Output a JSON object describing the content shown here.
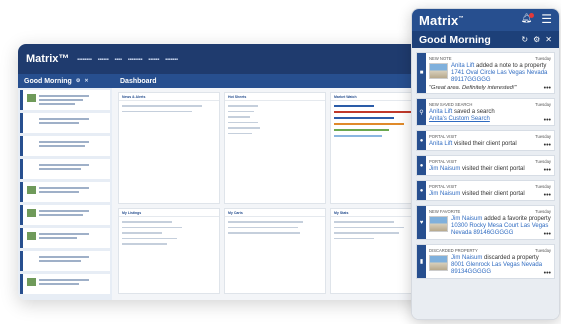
{
  "desktop": {
    "logo": "Matrix™",
    "good_morning": "Good Morning",
    "dashboard": "Dashboard",
    "widgets": {
      "news": "News & Alerts",
      "hot_sheets": "Hot Sheets",
      "market_watch": "Market Watch",
      "my_listings": "My Listings",
      "my_carts": "My Carts",
      "my_stats": "My Stats"
    }
  },
  "phone": {
    "logo": "Matrix",
    "logo_tm": "™",
    "good_morning": "Good Morning",
    "feed": [
      {
        "type": "NEW NOTE",
        "day": "Tuesday",
        "name": "Anita Lift",
        "action": " added a note to a property",
        "address": "1741 Oval Circle Las Vegas Nevada 89117GGGGG",
        "quote": "\"Great area. Definitely interested!\"",
        "icon": "note-icon"
      },
      {
        "type": "NEW SAVED SEARCH",
        "day": "Tuesday",
        "name": "Anita Lift",
        "action": " saved a search",
        "link": "Anita's Custom Search",
        "icon": "search-icon"
      },
      {
        "type": "PORTAL VISIT",
        "day": "Tuesday",
        "name": "Anita Lift",
        "action": " visited their client portal",
        "icon": "dot-icon"
      },
      {
        "type": "PORTAL VISIT",
        "day": "Tuesday",
        "name": "Jim Naisum",
        "action": " visited their client portal",
        "icon": "dot-icon"
      },
      {
        "type": "PORTAL VISIT",
        "day": "Tuesday",
        "name": "Jim Naisum",
        "action": " visited their client portal",
        "icon": "dot-icon"
      },
      {
        "type": "NEW FAVORITE",
        "day": "Tuesday",
        "name": "Jim Naisum",
        "action": " added a favorite property",
        "address": "10300 Rocky Mesa Court Las Vegas Nevada 89146GGGGG",
        "icon": "heart-icon"
      },
      {
        "type": "DISCARDED PROPERTY",
        "day": "Tuesday",
        "name": "Jim Naisum",
        "action": " discarded a property",
        "address": "8001 Glenrock Las Vegas Nevada 89134GGGGG",
        "icon": "trash-icon"
      }
    ]
  }
}
